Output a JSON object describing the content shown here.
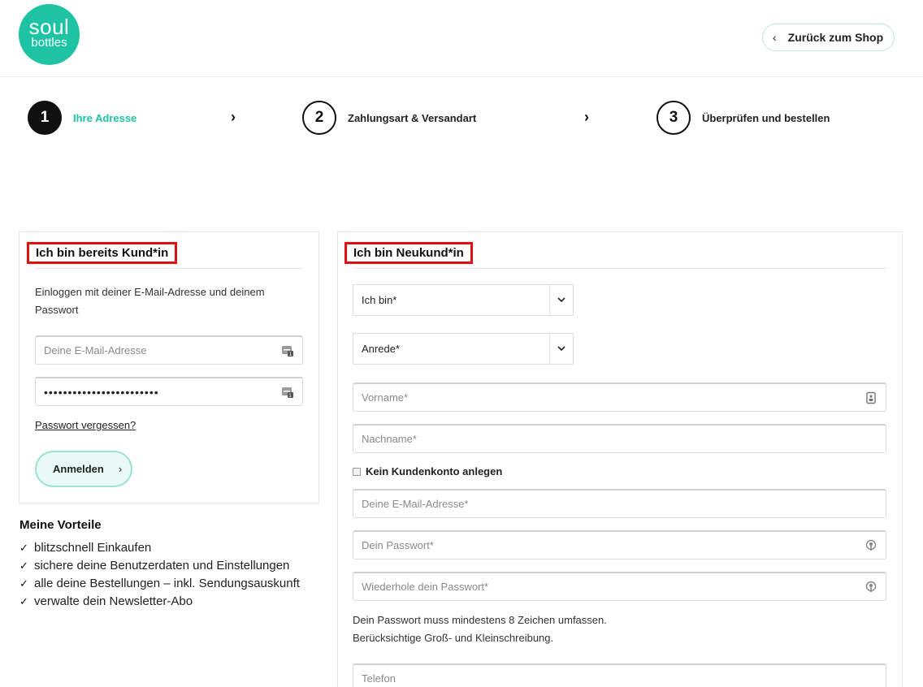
{
  "brand": {
    "logo_line1": "soul",
    "logo_line2": "bottles",
    "accent": "#1ec3a4"
  },
  "header": {
    "back_label": "Zurück zum Shop"
  },
  "steps": [
    {
      "number": "1",
      "label": "Ihre Adresse",
      "active": true
    },
    {
      "number": "2",
      "label": "Zahlungsart & Versandart",
      "active": false
    },
    {
      "number": "3",
      "label": "Überprüfen und bestellen",
      "active": false
    }
  ],
  "login": {
    "title": "Ich bin bereits Kund*in",
    "intro": "Einloggen mit deiner E-Mail-Adresse und deinem Passwort",
    "email_placeholder": "Deine E-Mail-Adresse",
    "password_value": "••••••••••••••••••••••••",
    "forgot_label": "Passwort vergessen?",
    "submit_label": "Anmelden"
  },
  "benefits": {
    "title": "Meine Vorteile",
    "items": [
      "blitzschnell Einkaufen",
      "sichere deine Benutzerdaten und Einstellungen",
      "alle deine Bestellungen – inkl. Sendungsauskunft",
      "verwalte dein Newsletter-Abo"
    ]
  },
  "register": {
    "title": "Ich bin Neukund*in",
    "iam_label": "Ich bin*",
    "salutation_label": "Anrede*",
    "firstname_placeholder": "Vorname*",
    "lastname_placeholder": "Nachname*",
    "no_account_label": "Kein Kundenkonto anlegen",
    "email_placeholder": "Deine E-Mail-Adresse*",
    "password_placeholder": "Dein Passwort*",
    "password_repeat_placeholder": "Wiederhole dein Passwort*",
    "password_hint_line1": "Dein Passwort muss mindestens 8 Zeichen umfassen.",
    "password_hint_line2": "Berücksichtige Groß- und Kleinschreibung.",
    "phone_placeholder": "Telefon"
  }
}
